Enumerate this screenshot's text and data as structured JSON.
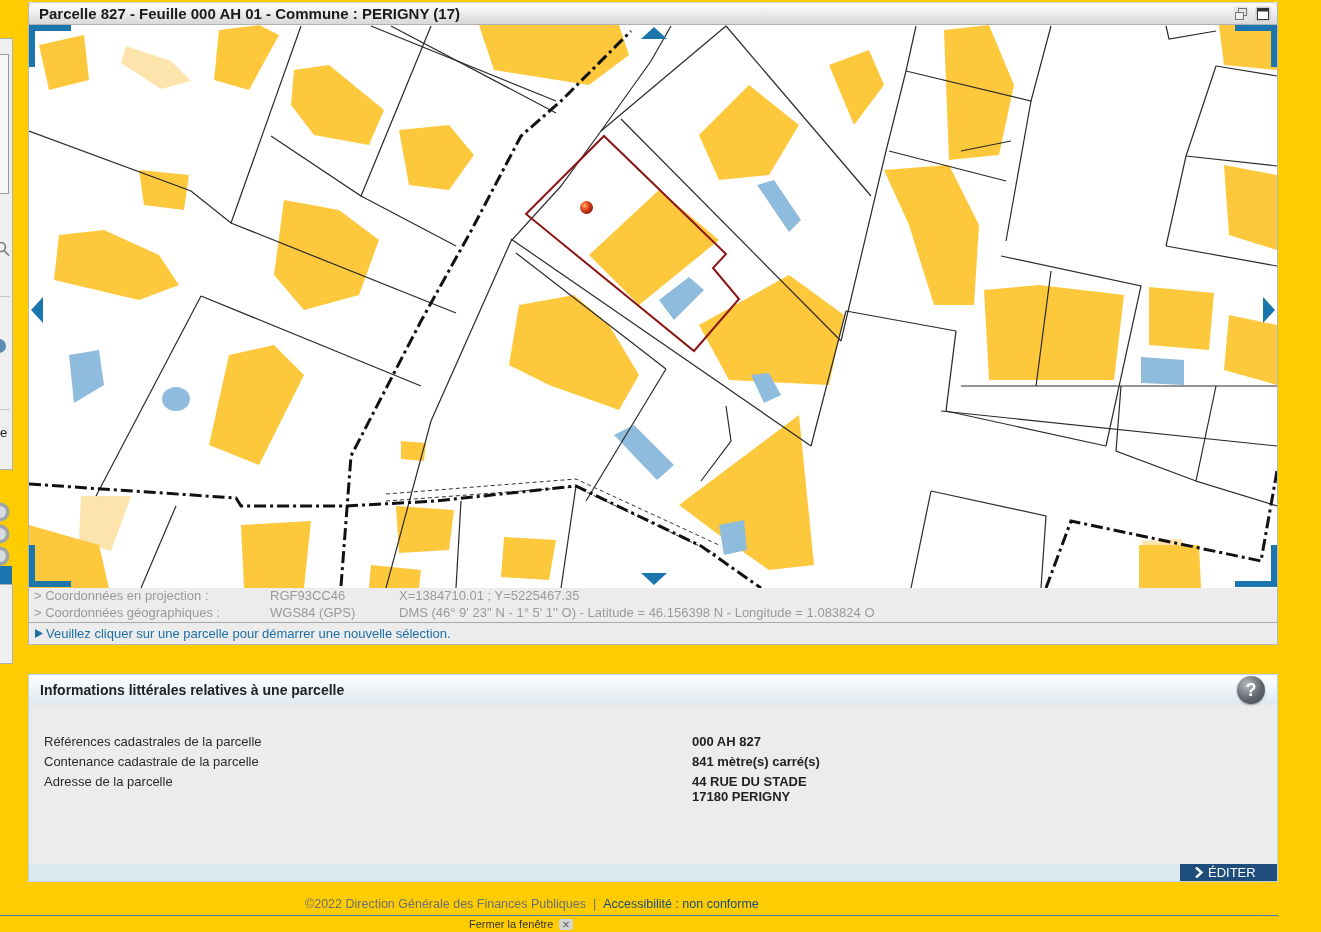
{
  "window": {
    "title": "Parcelle 827 - Feuille 000 AH 01 - Commune : PERIGNY (17)"
  },
  "side_panel": {
    "fragment": "e"
  },
  "coordinates": [
    {
      "label": "> Coordonnées en projection :",
      "system": "RGF93CC46",
      "value": "X=1384710.01 ; Y=5225467.35"
    },
    {
      "label": "> Coordonnées géographiques :",
      "system": "WGS84 (GPS)",
      "value": "DMS (46° 9' 23'' N - 1° 5' 1'' O) - Latitude = 46.156398 N - Longitude = 1.083824 O"
    }
  ],
  "instruction": "Veuillez cliquer sur une parcelle pour démarrer une nouvelle sélection.",
  "info_panel": {
    "title": "Informations littérales relatives à une parcelle",
    "help": "?",
    "rows": [
      {
        "label": "Références cadastrales de la parcelle",
        "value": [
          "000 AH 827"
        ]
      },
      {
        "label": "Contenance cadastrale de la parcelle",
        "value": [
          "841 mètre(s) carré(s)"
        ]
      },
      {
        "label": "Adresse de la parcelle",
        "value": [
          "44 RUE DU STADE",
          "17180 PERIGNY"
        ]
      }
    ],
    "edit_button": "ÉDITER"
  },
  "footer": {
    "copyright": "©2022 Direction Générale des Finances Publiques",
    "separator": "|",
    "accessibility_link": "Accessibilité : non conforme",
    "close_link": "Fermer la fenêtre"
  }
}
